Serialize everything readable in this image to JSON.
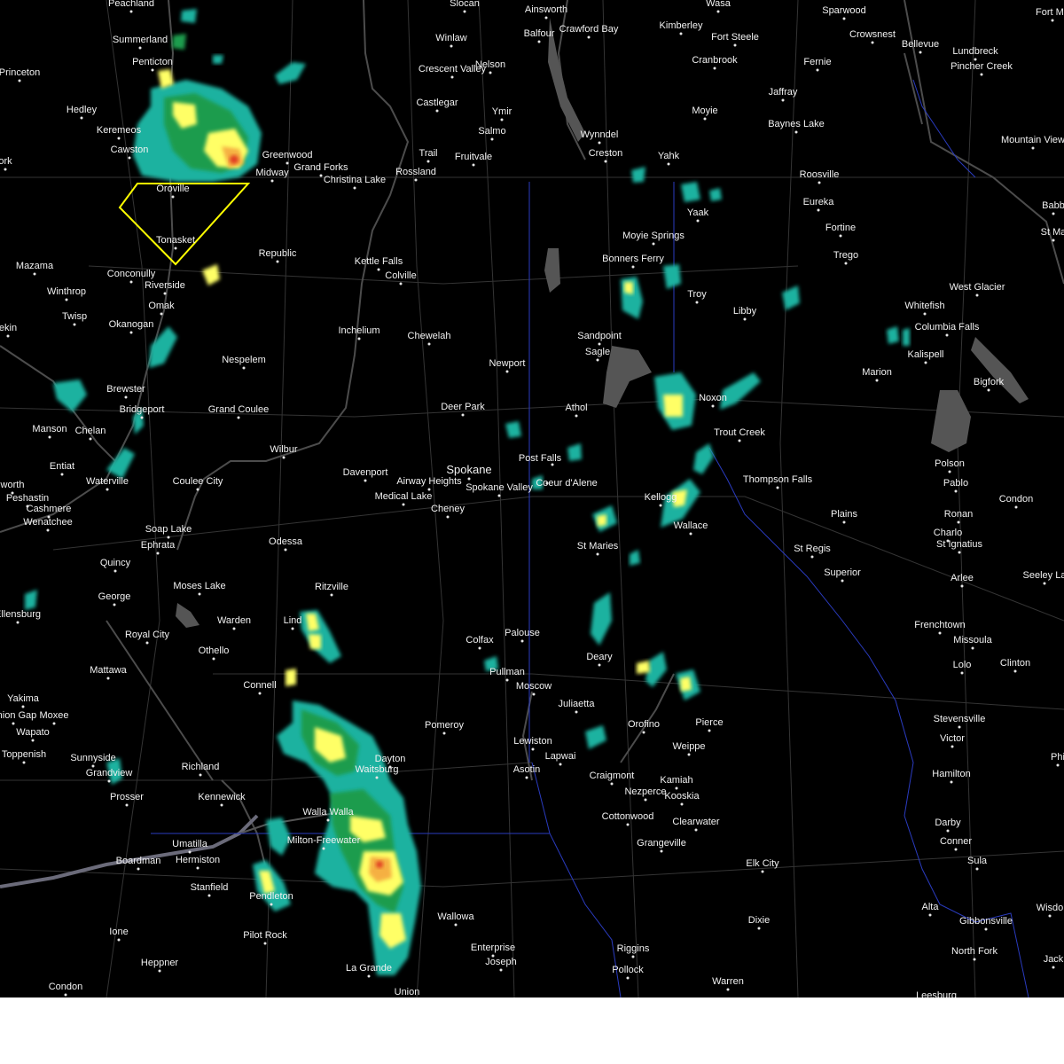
{
  "map": {
    "colors": {
      "background": "#000000",
      "roads": "#3a3a3a",
      "rivers": "#555555",
      "lakes": "#555555",
      "state_border": "#2c3bb5",
      "warning_polygon": "#ffff00",
      "radar_light": "#1ab2a0",
      "radar_mid": "#1f9c4e",
      "radar_yellow": "#ffff66",
      "radar_orange": "#f5b042",
      "radar_red": "#e03c20"
    },
    "places": [
      {
        "name": "Peachland"
      },
      {
        "name": "Slocan"
      },
      {
        "name": "Ainsworth"
      },
      {
        "name": "Wasa"
      },
      {
        "name": "Sparwood"
      },
      {
        "name": "Fort Ma"
      },
      {
        "name": "Summerland"
      },
      {
        "name": "Winlaw"
      },
      {
        "name": "Balfour"
      },
      {
        "name": "Crawford Bay"
      },
      {
        "name": "Kimberley"
      },
      {
        "name": "Fort Steele"
      },
      {
        "name": "Crowsnest"
      },
      {
        "name": "Bellevue"
      },
      {
        "name": "Lundbreck"
      },
      {
        "name": "Princeton"
      },
      {
        "name": "Penticton"
      },
      {
        "name": "Crescent Valley"
      },
      {
        "name": "Nelson"
      },
      {
        "name": "Cranbrook"
      },
      {
        "name": "Fernie"
      },
      {
        "name": "Pincher Creek"
      },
      {
        "name": "Hedley"
      },
      {
        "name": "Castlegar"
      },
      {
        "name": "Jaffray"
      },
      {
        "name": "Moyie"
      },
      {
        "name": "Ymir"
      },
      {
        "name": "Baynes Lake"
      },
      {
        "name": "Keremeos"
      },
      {
        "name": "Salmo"
      },
      {
        "name": "Mountain View"
      },
      {
        "name": "Wynndel"
      },
      {
        "name": "Cawston"
      },
      {
        "name": "Greenwood"
      },
      {
        "name": "Trail"
      },
      {
        "name": "Fruitvale"
      },
      {
        "name": "Creston"
      },
      {
        "name": "Yahk"
      },
      {
        "name": "Grand Forks"
      },
      {
        "name": "Midway"
      },
      {
        "name": "Rossland"
      },
      {
        "name": "Christina Lake"
      },
      {
        "name": "Roosville"
      },
      {
        "name": "Oroville"
      },
      {
        "name": "Yaak"
      },
      {
        "name": "Eureka"
      },
      {
        "name": "Babb"
      },
      {
        "name": "Fortine"
      },
      {
        "name": "Tonasket"
      },
      {
        "name": "Moyie Springs"
      },
      {
        "name": "St Ma"
      },
      {
        "name": "Republic"
      },
      {
        "name": "Trego"
      },
      {
        "name": "Bonners Ferry"
      },
      {
        "name": "Kettle Falls"
      },
      {
        "name": "Mazama"
      },
      {
        "name": "Conconully"
      },
      {
        "name": "Colville"
      },
      {
        "name": "Troy"
      },
      {
        "name": "West Glacier"
      },
      {
        "name": "Winthrop"
      },
      {
        "name": "Riverside"
      },
      {
        "name": "Whitefish"
      },
      {
        "name": "Libby"
      },
      {
        "name": "Omak"
      },
      {
        "name": "Twisp"
      },
      {
        "name": "Sandpoint"
      },
      {
        "name": "Columbia Falls"
      },
      {
        "name": "Okanogan"
      },
      {
        "name": "Inchelium"
      },
      {
        "name": "Chewelah"
      },
      {
        "name": "Sagle"
      },
      {
        "name": "Kalispell"
      },
      {
        "name": "Nespelem"
      },
      {
        "name": "Newport"
      },
      {
        "name": "Marion"
      },
      {
        "name": "Bigfork"
      },
      {
        "name": "Brewster"
      },
      {
        "name": "Noxon"
      },
      {
        "name": "Bridgeport"
      },
      {
        "name": "Deer Park"
      },
      {
        "name": "Athol"
      },
      {
        "name": "Grand Coulee"
      },
      {
        "name": "Manson"
      },
      {
        "name": "Chelan"
      },
      {
        "name": "Trout Creek"
      },
      {
        "name": "Polson"
      },
      {
        "name": "Wilbur"
      },
      {
        "name": "Entiat"
      },
      {
        "name": "Spokane"
      },
      {
        "name": "Post Falls"
      },
      {
        "name": "Davenport"
      },
      {
        "name": "Airway Heights"
      },
      {
        "name": "Thompson Falls"
      },
      {
        "name": "Waterville"
      },
      {
        "name": "Coulee City"
      },
      {
        "name": "Coeur d'Alene"
      },
      {
        "name": "Pablo"
      },
      {
        "name": "Spokane Valley"
      },
      {
        "name": "Peshastin"
      },
      {
        "name": "Medical Lake"
      },
      {
        "name": "Kellogg"
      },
      {
        "name": "Condon"
      },
      {
        "name": "Cashmere"
      },
      {
        "name": "Cheney"
      },
      {
        "name": "Wallace"
      },
      {
        "name": "Ronan"
      },
      {
        "name": "Plains"
      },
      {
        "name": "Wenatchee"
      },
      {
        "name": "Soap Lake"
      },
      {
        "name": "Charlo"
      },
      {
        "name": "Odessa"
      },
      {
        "name": "St Ignatius"
      },
      {
        "name": "Ephrata"
      },
      {
        "name": "St Maries"
      },
      {
        "name": "St Regis"
      },
      {
        "name": "Quincy"
      },
      {
        "name": "Superior"
      },
      {
        "name": "Seeley La"
      },
      {
        "name": "Arlee"
      },
      {
        "name": "Moses Lake"
      },
      {
        "name": "Ritzville"
      },
      {
        "name": "George"
      },
      {
        "name": "Warden"
      },
      {
        "name": "Frenchtown"
      },
      {
        "name": "Lind"
      },
      {
        "name": "Ellensburg"
      },
      {
        "name": "Royal City"
      },
      {
        "name": "Colfax"
      },
      {
        "name": "Palouse"
      },
      {
        "name": "Missoula"
      },
      {
        "name": "Othello"
      },
      {
        "name": "Deary"
      },
      {
        "name": "Lolo"
      },
      {
        "name": "Clinton"
      },
      {
        "name": "Mattawa"
      },
      {
        "name": "Pullman"
      },
      {
        "name": "Connell"
      },
      {
        "name": "Moscow"
      },
      {
        "name": "Yakima"
      },
      {
        "name": "Juliaetta"
      },
      {
        "name": "Union Gap"
      },
      {
        "name": "Moxee"
      },
      {
        "name": "Stevensville"
      },
      {
        "name": "Pomeroy"
      },
      {
        "name": "Orofino"
      },
      {
        "name": "Pierce"
      },
      {
        "name": "Wapato"
      },
      {
        "name": "Victor"
      },
      {
        "name": "Lewiston"
      },
      {
        "name": "Weippe"
      },
      {
        "name": "Toppenish"
      },
      {
        "name": "Lapwai"
      },
      {
        "name": "Dayton"
      },
      {
        "name": "Sunnyside"
      },
      {
        "name": "Richland"
      },
      {
        "name": "Asotin"
      },
      {
        "name": "Waitsburg"
      },
      {
        "name": "Grandview"
      },
      {
        "name": "Craigmont"
      },
      {
        "name": "Hamilton"
      },
      {
        "name": "Kamiah"
      },
      {
        "name": "Prosser"
      },
      {
        "name": "Kennewick"
      },
      {
        "name": "Nezperce"
      },
      {
        "name": "Kooskia"
      },
      {
        "name": "Walla Walla"
      },
      {
        "name": "Cottonwood"
      },
      {
        "name": "Darby"
      },
      {
        "name": "Clearwater"
      },
      {
        "name": "Milton-Freewater"
      },
      {
        "name": "Umatilla"
      },
      {
        "name": "Grangeville"
      },
      {
        "name": "Conner"
      },
      {
        "name": "Boardman"
      },
      {
        "name": "Hermiston"
      },
      {
        "name": "Elk City"
      },
      {
        "name": "Sula"
      },
      {
        "name": "Stanfield"
      },
      {
        "name": "Pendleton"
      },
      {
        "name": "Alta"
      },
      {
        "name": "Wisdo"
      },
      {
        "name": "Wallowa"
      },
      {
        "name": "Dixie"
      },
      {
        "name": "Ione"
      },
      {
        "name": "Gibbonsville"
      },
      {
        "name": "Pilot Rock"
      },
      {
        "name": "Enterprise"
      },
      {
        "name": "Riggins"
      },
      {
        "name": "North Fork"
      },
      {
        "name": "Joseph"
      },
      {
        "name": "Jack"
      },
      {
        "name": "Heppner"
      },
      {
        "name": "Pollock"
      },
      {
        "name": "La Grande"
      },
      {
        "name": "Warren"
      },
      {
        "name": "Condon"
      },
      {
        "name": "Union"
      },
      {
        "name": "Leesburg"
      },
      {
        "name": "ork"
      },
      {
        "name": "ekin"
      },
      {
        "name": "worth"
      },
      {
        "name": "Phi"
      }
    ]
  }
}
